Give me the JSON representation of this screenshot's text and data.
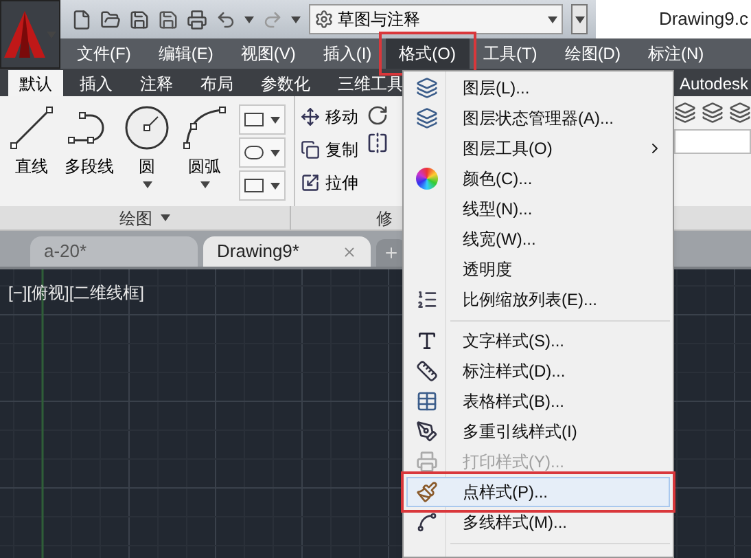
{
  "quick_access": {
    "workspace": "草图与注释"
  },
  "document_title": "Drawing9.c",
  "menu_bar": [
    {
      "label": "文件(F)",
      "selected": false,
      "annotated": false
    },
    {
      "label": "编辑(E)",
      "selected": false,
      "annotated": false
    },
    {
      "label": "视图(V)",
      "selected": false,
      "annotated": false
    },
    {
      "label": "插入(I)",
      "selected": false,
      "annotated": false
    },
    {
      "label": "格式(O)",
      "selected": true,
      "annotated": true
    },
    {
      "label": "工具(T)",
      "selected": false,
      "annotated": false
    },
    {
      "label": "绘图(D)",
      "selected": false,
      "annotated": false
    },
    {
      "label": "标注(N)",
      "selected": false,
      "annotated": false
    }
  ],
  "ribbon_tabs": [
    {
      "label": "默认",
      "selected": true
    },
    {
      "label": "插入",
      "selected": false
    },
    {
      "label": "注释",
      "selected": false
    },
    {
      "label": "布局",
      "selected": false
    },
    {
      "label": "参数化",
      "selected": false
    },
    {
      "label": "三维工具",
      "selected": false
    },
    {
      "label": "Autodesk",
      "selected": false
    }
  ],
  "draw_panel": {
    "title": "绘图",
    "tools": [
      {
        "label": "直线",
        "dropdown": false
      },
      {
        "label": "多段线",
        "dropdown": false
      },
      {
        "label": "圆",
        "dropdown": true
      },
      {
        "label": "圆弧",
        "dropdown": true
      }
    ]
  },
  "modify_panel": {
    "title": "修",
    "tools": [
      {
        "label": "移动"
      },
      {
        "label": "复制"
      },
      {
        "label": "拉伸"
      }
    ]
  },
  "document_tabs": [
    {
      "label": "a-20*",
      "selected": false
    },
    {
      "label": "Drawing9*",
      "selected": true
    }
  ],
  "viewport": {
    "label": "[−][俯视][二维线框]"
  },
  "format_menu": {
    "items": [
      {
        "kind": "item",
        "label": "图层(L)...",
        "disabled": false,
        "selected": false,
        "submenu": false,
        "annotated": false
      },
      {
        "kind": "item",
        "label": "图层状态管理器(A)...",
        "disabled": false,
        "selected": false,
        "submenu": false,
        "annotated": false
      },
      {
        "kind": "item",
        "label": "图层工具(O)",
        "disabled": false,
        "selected": false,
        "submenu": true,
        "annotated": false
      },
      {
        "kind": "item",
        "label": "颜色(C)...",
        "disabled": false,
        "selected": false,
        "submenu": false,
        "annotated": false
      },
      {
        "kind": "item",
        "label": "线型(N)...",
        "disabled": false,
        "selected": false,
        "submenu": false,
        "annotated": false
      },
      {
        "kind": "item",
        "label": "线宽(W)...",
        "disabled": false,
        "selected": false,
        "submenu": false,
        "annotated": false
      },
      {
        "kind": "item",
        "label": "透明度",
        "disabled": false,
        "selected": false,
        "submenu": false,
        "annotated": false
      },
      {
        "kind": "item",
        "label": "比例缩放列表(E)...",
        "disabled": false,
        "selected": false,
        "submenu": false,
        "annotated": false
      },
      {
        "kind": "separator"
      },
      {
        "kind": "item",
        "label": "文字样式(S)...",
        "disabled": false,
        "selected": false,
        "submenu": false,
        "annotated": false
      },
      {
        "kind": "item",
        "label": "标注样式(D)...",
        "disabled": false,
        "selected": false,
        "submenu": false,
        "annotated": false
      },
      {
        "kind": "item",
        "label": "表格样式(B)...",
        "disabled": false,
        "selected": false,
        "submenu": false,
        "annotated": false
      },
      {
        "kind": "item",
        "label": "多重引线样式(I)",
        "disabled": false,
        "selected": false,
        "submenu": false,
        "annotated": false
      },
      {
        "kind": "item",
        "label": "打印样式(Y)...",
        "disabled": true,
        "selected": false,
        "submenu": false,
        "annotated": false
      },
      {
        "kind": "item",
        "label": "点样式(P)...",
        "disabled": false,
        "selected": true,
        "submenu": false,
        "annotated": true
      },
      {
        "kind": "item",
        "label": "多线样式(M)...",
        "disabled": false,
        "selected": false,
        "submenu": false,
        "annotated": false
      },
      {
        "kind": "separator"
      }
    ]
  }
}
